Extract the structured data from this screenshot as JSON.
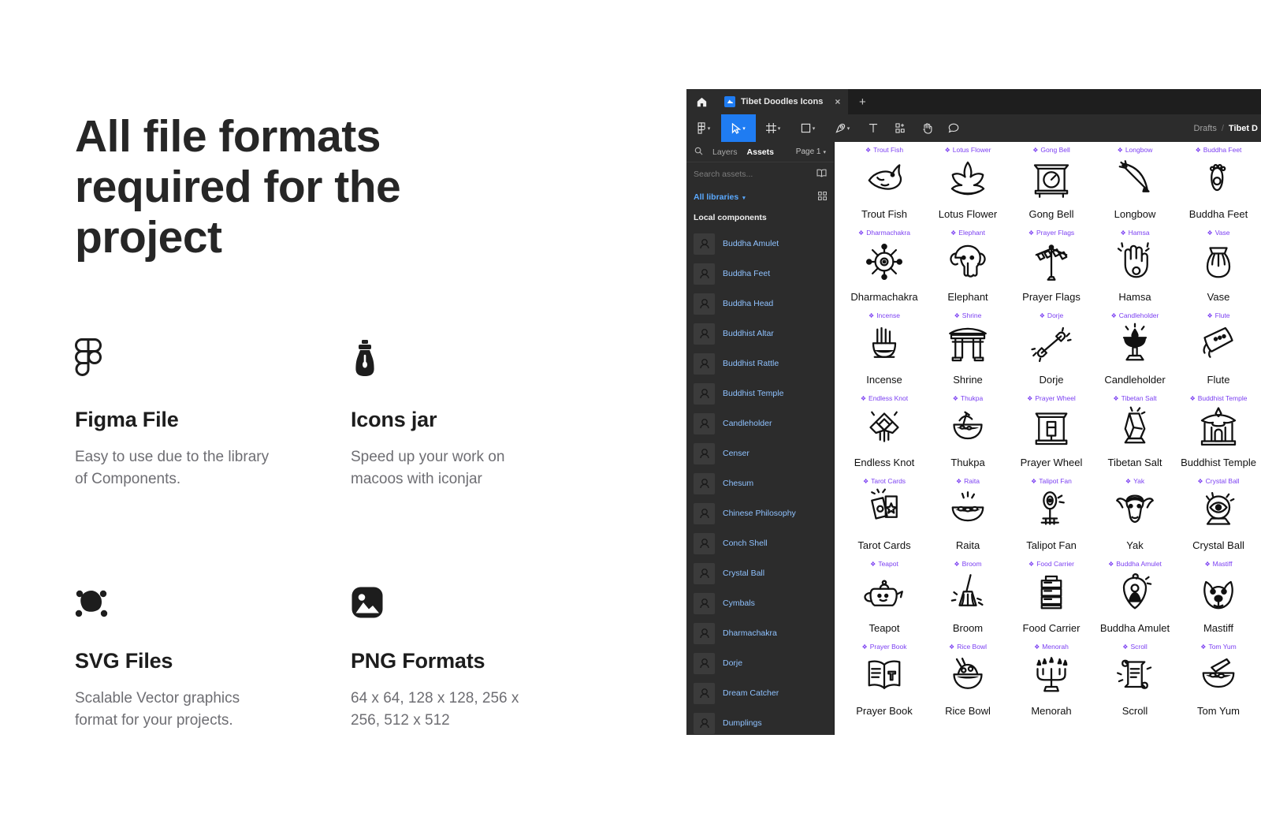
{
  "marketing": {
    "headline": "All file formats required for the project",
    "features": [
      {
        "icon": "figma-logo-icon",
        "title": "Figma File",
        "desc": "Easy to use due to the library of Components."
      },
      {
        "icon": "icon-jar-icon",
        "title": "Icons jar",
        "desc": "Speed up your work on macoos with iconjar"
      },
      {
        "icon": "svg-vector-node-icon",
        "title": "SVG Files",
        "desc": "Scalable Vector graphics format for your projects."
      },
      {
        "icon": "image-png-icon",
        "title": "PNG Formats",
        "desc": "64 x 64, 128 x 128, 256 x 256, 512 x 512"
      }
    ]
  },
  "figma": {
    "tab": {
      "title": "Tibet Doodles Icons",
      "close_label": "×",
      "new_tab_label": "+"
    },
    "home_icon": "home-icon",
    "toolbar": {
      "items": [
        {
          "name": "figma-menu-icon",
          "chevron": true,
          "active": false
        },
        {
          "name": "move-tool-icon",
          "chevron": true,
          "active": true
        },
        {
          "name": "frame-tool-icon",
          "chevron": true,
          "active": false
        },
        {
          "name": "shape-tool-icon",
          "chevron": true,
          "active": false
        },
        {
          "name": "pen-tool-icon",
          "chevron": true,
          "active": false
        },
        {
          "name": "text-tool-icon",
          "chevron": false,
          "active": false
        },
        {
          "name": "components-tool-icon",
          "chevron": false,
          "active": false
        },
        {
          "name": "hand-tool-icon",
          "chevron": false,
          "active": false
        },
        {
          "name": "comment-tool-icon",
          "chevron": false,
          "active": false
        }
      ]
    },
    "breadcrumb": {
      "root": "Drafts",
      "separator": "/",
      "current": "Tibet D"
    },
    "panel": {
      "search_icon": "search-icon",
      "tabs": [
        {
          "label": "Layers",
          "active": false
        },
        {
          "label": "Assets",
          "active": true
        }
      ],
      "page_selector": "Page 1",
      "search_placeholder": "Search assets...",
      "library_icon": "book-icon",
      "libraries_label": "All libraries",
      "grid_view_icon": "grid-view-icon",
      "section_label": "Local components",
      "components": [
        "Buddha Amulet",
        "Buddha Feet",
        "Buddha Head",
        "Buddhist Altar",
        "Buddhist Rattle",
        "Buddhist Temple",
        "Candleholder",
        "Censer",
        "Chesum",
        "Chinese Philosophy",
        "Conch Shell",
        "Crystal Ball",
        "Cymbals",
        "Dharmachakra",
        "Dorje",
        "Dream Catcher",
        "Dumplings"
      ]
    },
    "canvas": {
      "icons": [
        {
          "label": "Trout Fish",
          "caption": "Trout Fish",
          "art": "fish"
        },
        {
          "label": "Lotus Flower",
          "caption": "Lotus Flower",
          "art": "lotus"
        },
        {
          "label": "Gong Bell",
          "caption": "Gong Bell",
          "art": "gong"
        },
        {
          "label": "Longbow",
          "caption": "Longbow",
          "art": "bow"
        },
        {
          "label": "Buddha Feet",
          "caption": "Buddha Feet",
          "art": "feet"
        },
        {
          "label": "Dharmachakra",
          "caption": "Dharmachakra",
          "art": "wheel"
        },
        {
          "label": "Elephant",
          "caption": "Elephant",
          "art": "elephant"
        },
        {
          "label": "Prayer Flags",
          "caption": "Prayer Flags",
          "art": "flags"
        },
        {
          "label": "Hamsa",
          "caption": "Hamsa",
          "art": "hamsa"
        },
        {
          "label": "Vase",
          "caption": "Vase",
          "art": "vase"
        },
        {
          "label": "Incense",
          "caption": "Incense",
          "art": "incense"
        },
        {
          "label": "Shrine",
          "caption": "Shrine",
          "art": "shrine"
        },
        {
          "label": "Dorje",
          "caption": "Dorje",
          "art": "dorje"
        },
        {
          "label": "Candleholder",
          "caption": "Candleholder",
          "art": "candle"
        },
        {
          "label": "Flute",
          "caption": "Flute",
          "art": "flute"
        },
        {
          "label": "Endless Knot",
          "caption": "Endless Knot",
          "art": "knot"
        },
        {
          "label": "Thukpa",
          "caption": "Thukpa",
          "art": "thukpa"
        },
        {
          "label": "Prayer Wheel",
          "caption": "Prayer Wheel",
          "art": "prayerwheel"
        },
        {
          "label": "Tibetan Salt",
          "caption": "Tibetan Salt",
          "art": "salt"
        },
        {
          "label": "Buddhist Temple",
          "caption": "Buddhist Temple",
          "art": "temple"
        },
        {
          "label": "Tarot Cards",
          "caption": "Tarot Cards",
          "art": "tarot"
        },
        {
          "label": "Raita",
          "caption": "Raita",
          "art": "raita"
        },
        {
          "label": "Talipot Fan",
          "caption": "Talipot Fan",
          "art": "fan"
        },
        {
          "label": "Yak",
          "caption": "Yak",
          "art": "yak"
        },
        {
          "label": "Crystal Ball",
          "caption": "Crystal Ball",
          "art": "crystal"
        },
        {
          "label": "Teapot",
          "caption": "Teapot",
          "art": "teapot"
        },
        {
          "label": "Broom",
          "caption": "Broom",
          "art": "broom"
        },
        {
          "label": "Food Carrier",
          "caption": "Food Carrier",
          "art": "carrier"
        },
        {
          "label": "Buddha Amulet",
          "caption": "Buddha Amulet",
          "art": "amulet"
        },
        {
          "label": "Mastiff",
          "caption": "Mastiff",
          "art": "mastiff"
        },
        {
          "label": "Prayer Book",
          "caption": "Prayer Book",
          "art": "book"
        },
        {
          "label": "Rice Bowl",
          "caption": "Rice Bowl",
          "art": "ricebowl"
        },
        {
          "label": "Menorah",
          "caption": "Menorah",
          "art": "menorah"
        },
        {
          "label": "Scroll",
          "caption": "Scroll",
          "art": "scroll"
        },
        {
          "label": "Tom Yum",
          "caption": "Tom Yum",
          "art": "tomyum"
        }
      ]
    }
  },
  "colors": {
    "accent_blue": "#1f7cf2",
    "component_purple": "#7b3ff2",
    "panel_bg": "#2c2c2c",
    "chrome_bg": "#1e1e1e",
    "link_blue": "#8fc2ff"
  }
}
